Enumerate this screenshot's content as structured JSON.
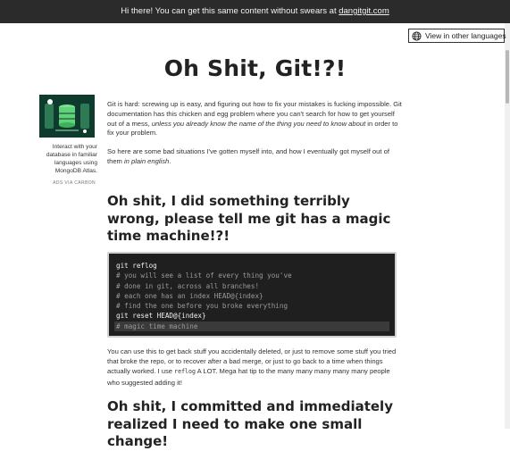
{
  "banner": {
    "prefix": "Hi there! You can get this same content without swears at",
    "link": "dangitgit.com"
  },
  "language_button": {
    "label": "View in other languages",
    "icon": "globe-icon"
  },
  "title": "Oh Shit, Git!?!",
  "ad": {
    "text": "Interact with your database in familiar languages using MongoDB Atlas.",
    "via": "ADS VIA CARBON"
  },
  "intro": {
    "p1_a": "Git is hard: screwing up is easy, and figuring out how to fix your mistakes is fucking impossible. Git documentation has this chicken and egg problem where you can't search for how to get yourself out of a mess, ",
    "p1_em": "unless you already know the name of the thing you need to know about",
    "p1_b": " in order to fix your problem.",
    "p2_a": "So here are some bad situations I've gotten myself into, and how I eventually got myself out of them ",
    "p2_em": "in plain english",
    "p2_b": "."
  },
  "section1": {
    "heading": "Oh shit, I did something terribly wrong, please tell me git has a magic time machine!?!",
    "code": [
      {
        "text": "git reflog",
        "type": "cmd"
      },
      {
        "text": "# you will see a list of every thing you've",
        "type": "comment"
      },
      {
        "text": "# done in git, across all branches!",
        "type": "comment"
      },
      {
        "text": "# each one has an index HEAD@{index}",
        "type": "comment"
      },
      {
        "text": "# find the one before you broke everything",
        "type": "comment"
      },
      {
        "text": "git reset HEAD@{index}",
        "type": "cmd"
      },
      {
        "text": "# magic time machine",
        "type": "comment-hl"
      }
    ],
    "para_a": "You can use this to get back stuff you accidentally deleted, or just to remove some stuff you tried that broke the repo, or to recover after a bad merge, or just to go back to a time when things actually worked. I use ",
    "para_code": "reflog",
    "para_b": " A LOT. Mega hat tip to the many many many many many people who suggested adding it!"
  },
  "section2": {
    "heading": "Oh shit, I committed and immediately realized I need to make one small change!"
  },
  "colors": {
    "banner_bg": "#2b2b2b",
    "code_bg": "#1f1f1f",
    "ad_bg": "#0e3b2e",
    "ad_accent": "#5fd27a"
  }
}
